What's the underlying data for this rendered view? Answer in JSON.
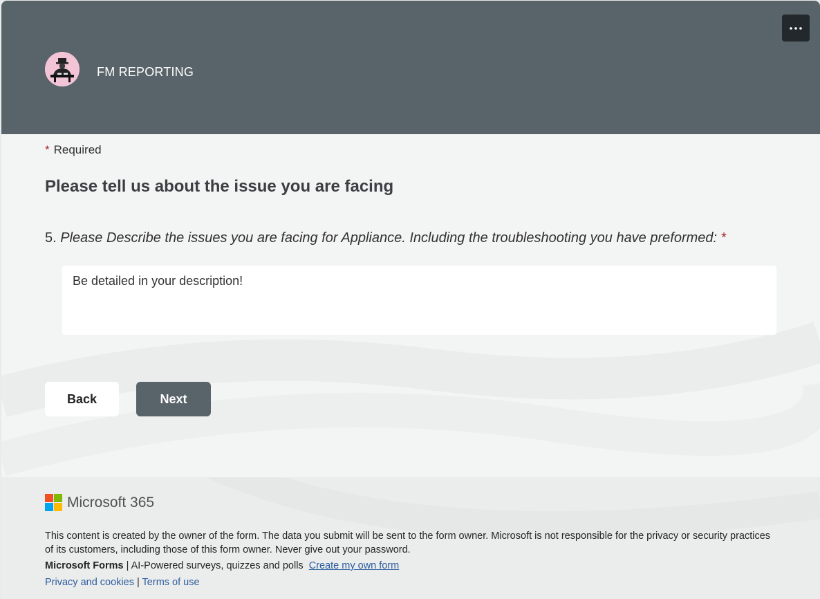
{
  "header": {
    "form_title": "FM REPORTING",
    "more_options_label": "..."
  },
  "body": {
    "required_star": "*",
    "required_label": "Required",
    "section_title": "Please tell us about the issue you are facing",
    "question": {
      "number": "5.",
      "text": "Please Describe the issues you are facing for Appliance. Including the troubleshooting you have preformed:",
      "required_star": "*",
      "answer_value": "Be detailed in your description!"
    },
    "buttons": {
      "back_label": "Back",
      "next_label": "Next"
    }
  },
  "footer": {
    "brand_name": "Microsoft 365",
    "brand_colors": [
      "#f25022",
      "#7fba00",
      "#00a4ef",
      "#ffb900"
    ],
    "disclaimer": "This content is created by the owner of the form. The data you submit will be sent to the form owner. Microsoft is not responsible for the privacy or security practices of its customers, including those of this form owner. Never give out your password.",
    "forms_name": "Microsoft Forms",
    "forms_separator": "|",
    "forms_tagline": "AI-Powered surveys, quizzes and polls",
    "create_link": "Create my own form",
    "privacy_link": "Privacy and cookies",
    "links_separator": "|",
    "terms_link": "Terms of use"
  },
  "colors": {
    "header_bg": "#59636a",
    "accent_required": "#a4262c",
    "link": "#2b5c9e",
    "avatar_bg": "#f3c4d6"
  }
}
